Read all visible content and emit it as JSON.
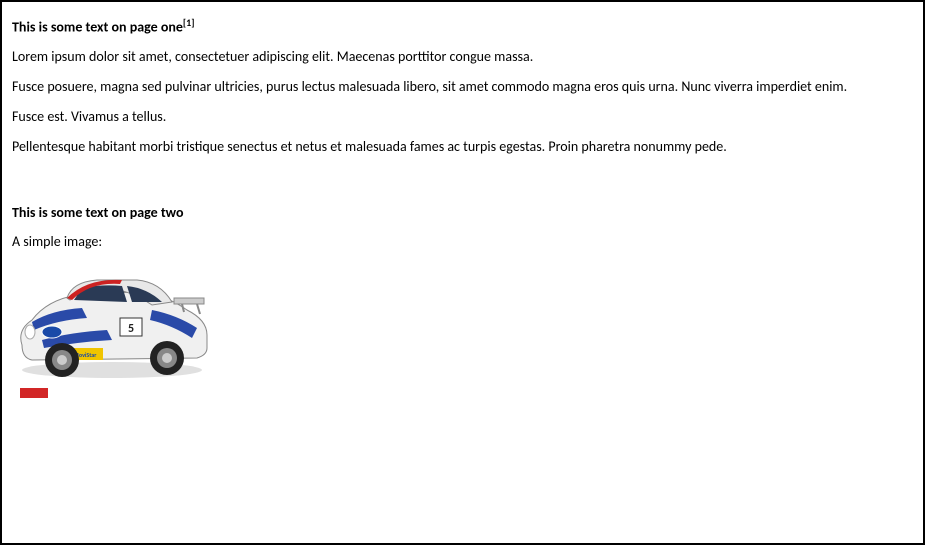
{
  "page_one": {
    "heading": "This is some text on page one",
    "footnote_ref": "[1]",
    "paragraphs": [
      "Lorem ipsum dolor sit amet, consectetuer adipiscing elit. Maecenas porttitor congue massa.",
      "Fusce posuere, magna sed pulvinar ultricies, purus lectus malesuada libero, sit amet commodo magna eros quis urna. Nunc viverra imperdiet enim.",
      "Fusce est. Vivamus a tellus.",
      "Pellentesque habitant morbi tristique senectus et netus et malesuada fames ac turpis egestas. Proin pharetra nonummy pede."
    ]
  },
  "page_two": {
    "heading": "This is some text on page two",
    "caption": "A simple image:",
    "image_name": "rally-car",
    "colors": {
      "red_bar": "#d22626"
    }
  }
}
